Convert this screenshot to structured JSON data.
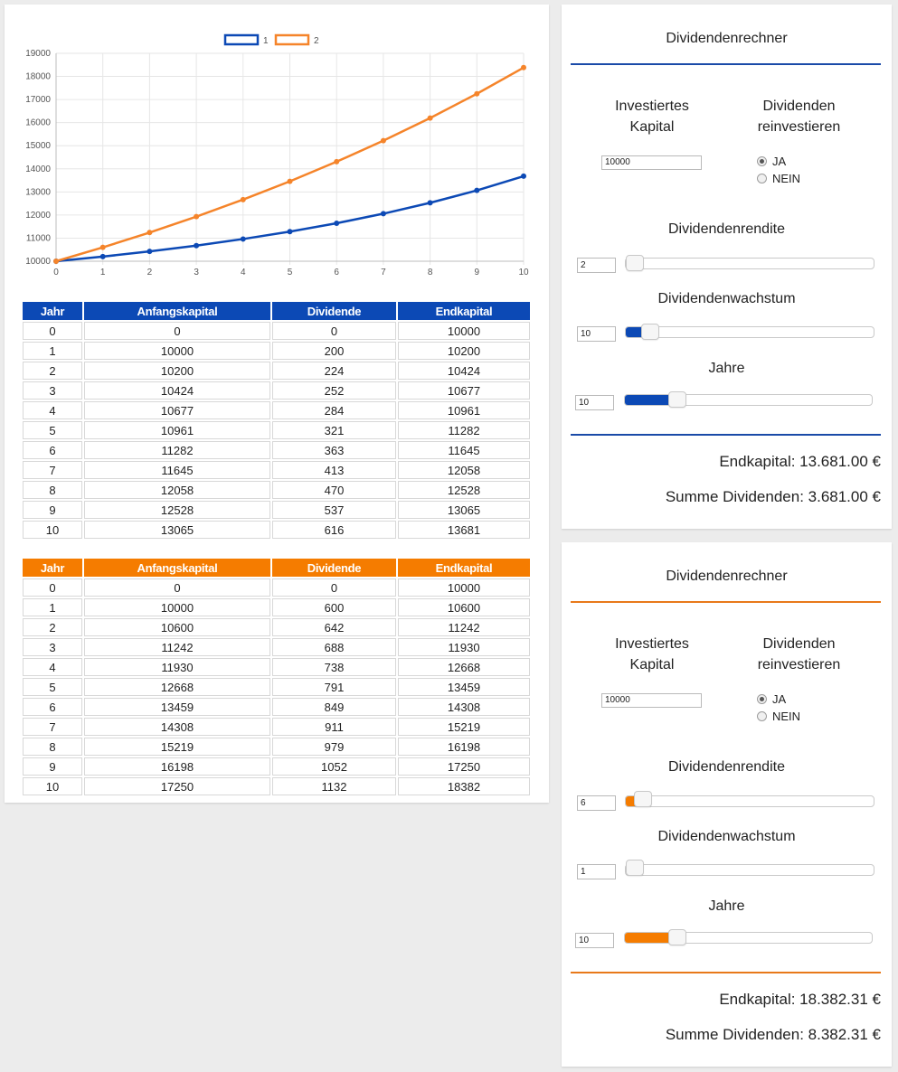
{
  "chart_data": {
    "type": "line",
    "x": [
      0,
      1,
      2,
      3,
      4,
      5,
      6,
      7,
      8,
      9,
      10
    ],
    "ylim": [
      10000,
      19000
    ],
    "yticks": [
      10000,
      11000,
      12000,
      13000,
      14000,
      15000,
      16000,
      17000,
      18000,
      19000
    ],
    "grid": true,
    "legend_position": "top",
    "series": [
      {
        "name": "1",
        "color": "#0c49b5",
        "values": [
          10000,
          10200,
          10424,
          10677,
          10961,
          11282,
          11645,
          12058,
          12528,
          13065,
          13681
        ]
      },
      {
        "name": "2",
        "color": "#f5842a",
        "values": [
          10000,
          10600,
          11242,
          11930,
          12668,
          13459,
          14308,
          15219,
          16198,
          17250,
          18382
        ]
      }
    ]
  },
  "tables": {
    "headers": [
      "Jahr",
      "Anfangskapital",
      "Dividende",
      "Endkapital"
    ],
    "blue_rows": [
      [
        "0",
        "0",
        "0",
        "10000"
      ],
      [
        "1",
        "10000",
        "200",
        "10200"
      ],
      [
        "2",
        "10200",
        "224",
        "10424"
      ],
      [
        "3",
        "10424",
        "252",
        "10677"
      ],
      [
        "4",
        "10677",
        "284",
        "10961"
      ],
      [
        "5",
        "10961",
        "321",
        "11282"
      ],
      [
        "6",
        "11282",
        "363",
        "11645"
      ],
      [
        "7",
        "11645",
        "413",
        "12058"
      ],
      [
        "8",
        "12058",
        "470",
        "12528"
      ],
      [
        "9",
        "12528",
        "537",
        "13065"
      ],
      [
        "10",
        "13065",
        "616",
        "13681"
      ]
    ],
    "orange_rows": [
      [
        "0",
        "0",
        "0",
        "10000"
      ],
      [
        "1",
        "10000",
        "600",
        "10600"
      ],
      [
        "2",
        "10600",
        "642",
        "11242"
      ],
      [
        "3",
        "11242",
        "688",
        "11930"
      ],
      [
        "4",
        "11930",
        "738",
        "12668"
      ],
      [
        "5",
        "12668",
        "791",
        "13459"
      ],
      [
        "6",
        "13459",
        "849",
        "14308"
      ],
      [
        "7",
        "14308",
        "911",
        "15219"
      ],
      [
        "8",
        "15219",
        "979",
        "16198"
      ],
      [
        "9",
        "16198",
        "1052",
        "17250"
      ],
      [
        "10",
        "17250",
        "1132",
        "18382"
      ]
    ]
  },
  "calculators": [
    {
      "title": "Dividendenrechner",
      "accent": "#0c49b5",
      "capital_label_1": "Investiertes",
      "capital_label_2": "Kapital",
      "capital_value": "10000",
      "reinvest_label_1": "Dividenden",
      "reinvest_label_2": "reinvestieren",
      "option_yes": "JA",
      "option_no": "NEIN",
      "reinvest_selected": "JA",
      "yield_label": "Dividendenrendite",
      "yield_value": "2",
      "yield_fraction": 0.0,
      "growth_label": "Dividendenwachstum",
      "growth_value": "10",
      "growth_fraction": 0.07,
      "years_label": "Jahre",
      "years_value": "10",
      "years_fraction": 0.18,
      "endkapital": "Endkapital: 13.681.00 €",
      "summe": "Summe Dividenden: 3.681.00 €"
    },
    {
      "title": "Dividendenrechner",
      "accent": "#f57c00",
      "capital_label_1": "Investiertes",
      "capital_label_2": "Kapital",
      "capital_value": "10000",
      "reinvest_label_1": "Dividenden",
      "reinvest_label_2": "reinvestieren",
      "option_yes": "JA",
      "option_no": "NEIN",
      "reinvest_selected": "JA",
      "yield_label": "Dividendenrendite",
      "yield_value": "6",
      "yield_fraction": 0.04,
      "growth_label": "Dividendenwachstum",
      "growth_value": "1",
      "growth_fraction": 0.0,
      "years_label": "Jahre",
      "years_value": "10",
      "years_fraction": 0.18,
      "endkapital": "Endkapital: 18.382.31 €",
      "summe": "Summe Dividenden: 8.382.31 €"
    }
  ]
}
